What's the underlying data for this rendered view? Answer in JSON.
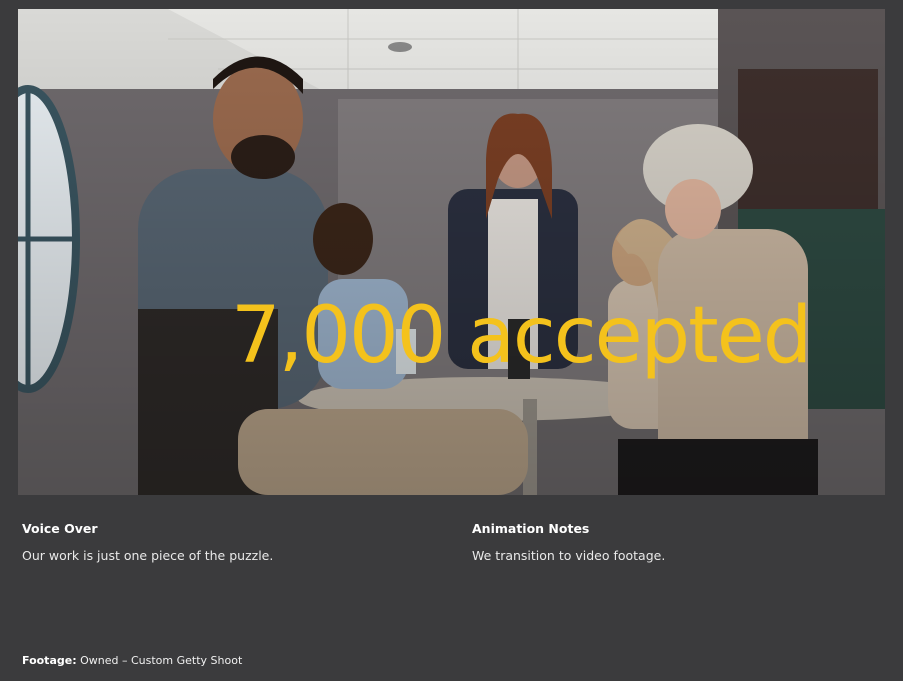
{
  "scene": {
    "overlay_text": "7,000 accepted",
    "accent_color": "#f4c21c"
  },
  "voice_over": {
    "title": "Voice Over",
    "text": "Our work is just one piece of the puzzle."
  },
  "animation_notes": {
    "title": "Animation Notes",
    "text": "We transition to video footage."
  },
  "footage": {
    "label": "Footage:",
    "value": "Owned – Custom Getty Shoot"
  }
}
